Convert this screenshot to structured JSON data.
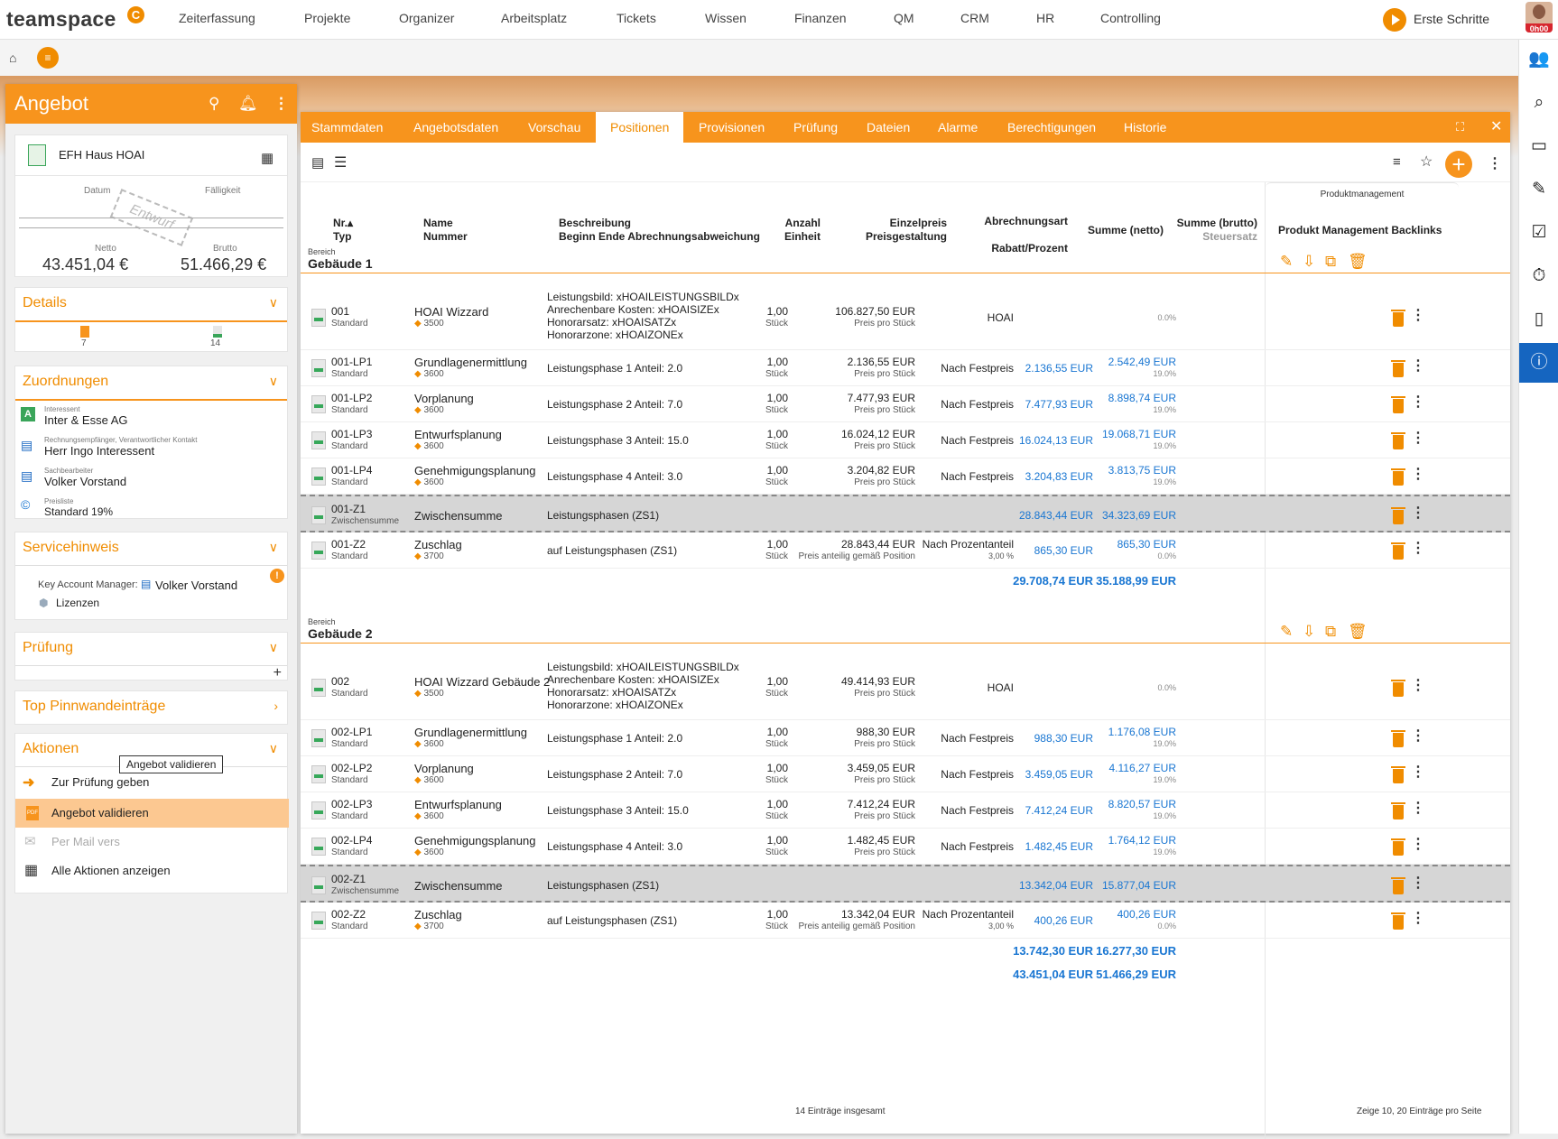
{
  "nav": {
    "logo": "teamspace",
    "items": [
      "Zeiterfassung",
      "Projekte",
      "Organizer",
      "Arbeitsplatz",
      "Tickets",
      "Wissen",
      "Finanzen",
      "QM",
      "CRM",
      "HR",
      "Controlling"
    ],
    "erste_schritte": "Erste Schritte",
    "timer": "0h00"
  },
  "left": {
    "title": "Angebot",
    "doc_name": "EFH Haus HOAI",
    "datum_label": "Datum",
    "faelligkeit_label": "Fälligkeit",
    "stamp": "Entwurf",
    "netto_label": "Netto",
    "brutto_label": "Brutto",
    "netto": "43.451,04 €",
    "brutto": "51.466,29 €",
    "details": "Details",
    "details_count1": "7",
    "details_count2": "14",
    "zuordnungen": "Zuordnungen",
    "z_items": [
      {
        "label": "Interessent",
        "value": "Inter & Esse AG"
      },
      {
        "label": "Rechnungsempfänger, Verantwortlicher Kontakt",
        "value": "Herr Ingo Interessent"
      },
      {
        "label": "Sachbearbeiter",
        "value": "Volker Vorstand"
      },
      {
        "label": "Preisliste",
        "value": "Standard 19%"
      }
    ],
    "servicehinweis": "Servicehinweis",
    "kam_label": "Key Account Manager:",
    "kam_value": "Volker Vorstand",
    "lizenzen": "Lizenzen",
    "pruefung": "Prüfung",
    "pinnwand": "Top Pinnwandeinträge",
    "aktionen": "Aktionen",
    "actions": [
      "Zur Prüfung geben",
      "Angebot validieren",
      "Per Mail vers",
      "Alle Aktionen anzeigen"
    ],
    "tooltip": "Angebot validieren"
  },
  "tabs": [
    "Stammdaten",
    "Angebotsdaten",
    "Vorschau",
    "Positionen",
    "Provisionen",
    "Prüfung",
    "Dateien",
    "Alarme",
    "Berechtigungen",
    "Historie"
  ],
  "headers": {
    "nr": "Nr.▴",
    "typ": "Typ",
    "name": "Name",
    "nummer": "Nummer",
    "beschreibung": "Beschreibung",
    "beginn": "Beginn Ende Abrechnungsabweichung",
    "anzahl": "Anzahl",
    "einheit": "Einheit",
    "einzelpreis": "Einzelpreis",
    "preisgestaltung": "Preisgestaltung",
    "abrechnungsart": "Abrechnungsart",
    "rabatt": "Rabatt/Prozent",
    "summe_netto": "Summe (netto)",
    "summe_brutto": "Summe (brutto)",
    "steuersatz": "Steuersatz",
    "pm_group": "Produktmanagement",
    "pm": "Produkt Management Backlinks"
  },
  "bereich_label": "Bereich",
  "sections": [
    {
      "title": "Gebäude 1",
      "rows": [
        {
          "nr": "001",
          "typ": "Standard",
          "name": "HOAI Wizzard",
          "num": "3500",
          "desc": [
            "Leistungsbild: xHOAILEISTUNGSBILDx",
            "Anrechenbare Kosten: xHOAISIZEx",
            "Honorarsatz: xHOAISATZx",
            "Honorarzone: xHOAIZONEx"
          ],
          "anz": "1,00",
          "einh": "Stück",
          "preis": "106.827,50 EUR",
          "pg": "Preis pro Stück",
          "art": "HOAI",
          "rab": "",
          "netto": "",
          "brutto": "",
          "st": "0.0%"
        },
        {
          "nr": "001-LP1",
          "typ": "Standard",
          "name": "Grundlagenermittlung",
          "num": "3600",
          "desc": [
            "Leistungsphase 1 Anteil: 2.0"
          ],
          "anz": "1,00",
          "einh": "Stück",
          "preis": "2.136,55 EUR",
          "pg": "Preis pro Stück",
          "art": "Nach Festpreis",
          "rab": "",
          "netto": "2.136,55 EUR",
          "brutto": "2.542,49 EUR",
          "st": "19.0%"
        },
        {
          "nr": "001-LP2",
          "typ": "Standard",
          "name": "Vorplanung",
          "num": "3600",
          "desc": [
            "Leistungsphase 2 Anteil: 7.0"
          ],
          "anz": "1,00",
          "einh": "Stück",
          "preis": "7.477,93 EUR",
          "pg": "Preis pro Stück",
          "art": "Nach Festpreis",
          "rab": "",
          "netto": "7.477,93 EUR",
          "brutto": "8.898,74 EUR",
          "st": "19.0%"
        },
        {
          "nr": "001-LP3",
          "typ": "Standard",
          "name": "Entwurfsplanung",
          "num": "3600",
          "desc": [
            "Leistungsphase 3 Anteil: 15.0"
          ],
          "anz": "1,00",
          "einh": "Stück",
          "preis": "16.024,12 EUR",
          "pg": "Preis pro Stück",
          "art": "Nach Festpreis",
          "rab": "",
          "netto": "16.024,13 EUR",
          "brutto": "19.068,71 EUR",
          "st": "19.0%"
        },
        {
          "nr": "001-LP4",
          "typ": "Standard",
          "name": "Genehmigungsplanung",
          "num": "3600",
          "desc": [
            "Leistungsphase 4 Anteil: 3.0"
          ],
          "anz": "1,00",
          "einh": "Stück",
          "preis": "3.204,82 EUR",
          "pg": "Preis pro Stück",
          "art": "Nach Festpreis",
          "rab": "",
          "netto": "3.204,83 EUR",
          "brutto": "3.813,75 EUR",
          "st": "19.0%"
        },
        {
          "nr": "001-Z1",
          "typ": "Zwischensumme",
          "name": "Zwischensumme",
          "num": "",
          "desc": [
            "Leistungsphasen (ZS1)"
          ],
          "anz": "",
          "einh": "",
          "preis": "",
          "pg": "",
          "art": "",
          "rab": "",
          "netto": "28.843,44 EUR",
          "brutto": "34.323,69 EUR",
          "st": "",
          "sub": true
        },
        {
          "nr": "001-Z2",
          "typ": "Standard",
          "name": "Zuschlag",
          "num": "3700",
          "desc": [
            "auf Leistungsphasen (ZS1)"
          ],
          "anz": "1,00",
          "einh": "Stück",
          "preis": "28.843,44 EUR",
          "pg": "Preis anteilig gemäß Position",
          "art": "Nach Prozentanteil",
          "rab": "3,00 %",
          "netto": "865,30 EUR",
          "brutto": "865,30 EUR",
          "st": "0.0%"
        }
      ],
      "total_netto": "29.708,74 EUR",
      "total_brutto": "35.188,99 EUR"
    },
    {
      "title": "Gebäude 2",
      "rows": [
        {
          "nr": "002",
          "typ": "Standard",
          "name": "HOAI Wizzard Gebäude 2",
          "num": "3500",
          "desc": [
            "Leistungsbild: xHOAILEISTUNGSBILDx",
            "Anrechenbare Kosten: xHOAISIZEx",
            "Honorarsatz: xHOAISATZx",
            "Honorarzone: xHOAIZONEx"
          ],
          "anz": "1,00",
          "einh": "Stück",
          "preis": "49.414,93 EUR",
          "pg": "Preis pro Stück",
          "art": "HOAI",
          "rab": "",
          "netto": "",
          "brutto": "",
          "st": "0.0%"
        },
        {
          "nr": "002-LP1",
          "typ": "Standard",
          "name": "Grundlagenermittlung",
          "num": "3600",
          "desc": [
            "Leistungsphase 1 Anteil: 2.0"
          ],
          "anz": "1,00",
          "einh": "Stück",
          "preis": "988,30 EUR",
          "pg": "Preis pro Stück",
          "art": "Nach Festpreis",
          "rab": "",
          "netto": "988,30 EUR",
          "brutto": "1.176,08 EUR",
          "st": "19.0%"
        },
        {
          "nr": "002-LP2",
          "typ": "Standard",
          "name": "Vorplanung",
          "num": "3600",
          "desc": [
            "Leistungsphase 2 Anteil: 7.0"
          ],
          "anz": "1,00",
          "einh": "Stück",
          "preis": "3.459,05 EUR",
          "pg": "Preis pro Stück",
          "art": "Nach Festpreis",
          "rab": "",
          "netto": "3.459,05 EUR",
          "brutto": "4.116,27 EUR",
          "st": "19.0%"
        },
        {
          "nr": "002-LP3",
          "typ": "Standard",
          "name": "Entwurfsplanung",
          "num": "3600",
          "desc": [
            "Leistungsphase 3 Anteil: 15.0"
          ],
          "anz": "1,00",
          "einh": "Stück",
          "preis": "7.412,24 EUR",
          "pg": "Preis pro Stück",
          "art": "Nach Festpreis",
          "rab": "",
          "netto": "7.412,24 EUR",
          "brutto": "8.820,57 EUR",
          "st": "19.0%"
        },
        {
          "nr": "002-LP4",
          "typ": "Standard",
          "name": "Genehmigungsplanung",
          "num": "3600",
          "desc": [
            "Leistungsphase 4 Anteil: 3.0"
          ],
          "anz": "1,00",
          "einh": "Stück",
          "preis": "1.482,45 EUR",
          "pg": "Preis pro Stück",
          "art": "Nach Festpreis",
          "rab": "",
          "netto": "1.482,45 EUR",
          "brutto": "1.764,12 EUR",
          "st": "19.0%"
        },
        {
          "nr": "002-Z1",
          "typ": "Zwischensumme",
          "name": "Zwischensumme",
          "num": "",
          "desc": [
            "Leistungsphasen (ZS1)"
          ],
          "anz": "",
          "einh": "",
          "preis": "",
          "pg": "",
          "art": "",
          "rab": "",
          "netto": "13.342,04 EUR",
          "brutto": "15.877,04 EUR",
          "st": "",
          "sub": true
        },
        {
          "nr": "002-Z2",
          "typ": "Standard",
          "name": "Zuschlag",
          "num": "3700",
          "desc": [
            "auf Leistungsphasen (ZS1)"
          ],
          "anz": "1,00",
          "einh": "Stück",
          "preis": "13.342,04 EUR",
          "pg": "Preis anteilig gemäß Position",
          "art": "Nach Prozentanteil",
          "rab": "3,00 %",
          "netto": "400,26 EUR",
          "brutto": "400,26 EUR",
          "st": "0.0%"
        }
      ],
      "total_netto": "13.742,30 EUR",
      "total_brutto": "16.277,30 EUR"
    }
  ],
  "grand_netto": "43.451,04 EUR",
  "grand_brutto": "51.466,29 EUR",
  "footer": {
    "count": "14 Einträge insgesamt",
    "zeige": "Zeige",
    "p10": "10",
    "p20": "20",
    "per_page": "Einträge pro Seite"
  },
  "colors": {
    "accent": "#f7941d",
    "link": "#1976d2",
    "info": "#1565c0"
  }
}
